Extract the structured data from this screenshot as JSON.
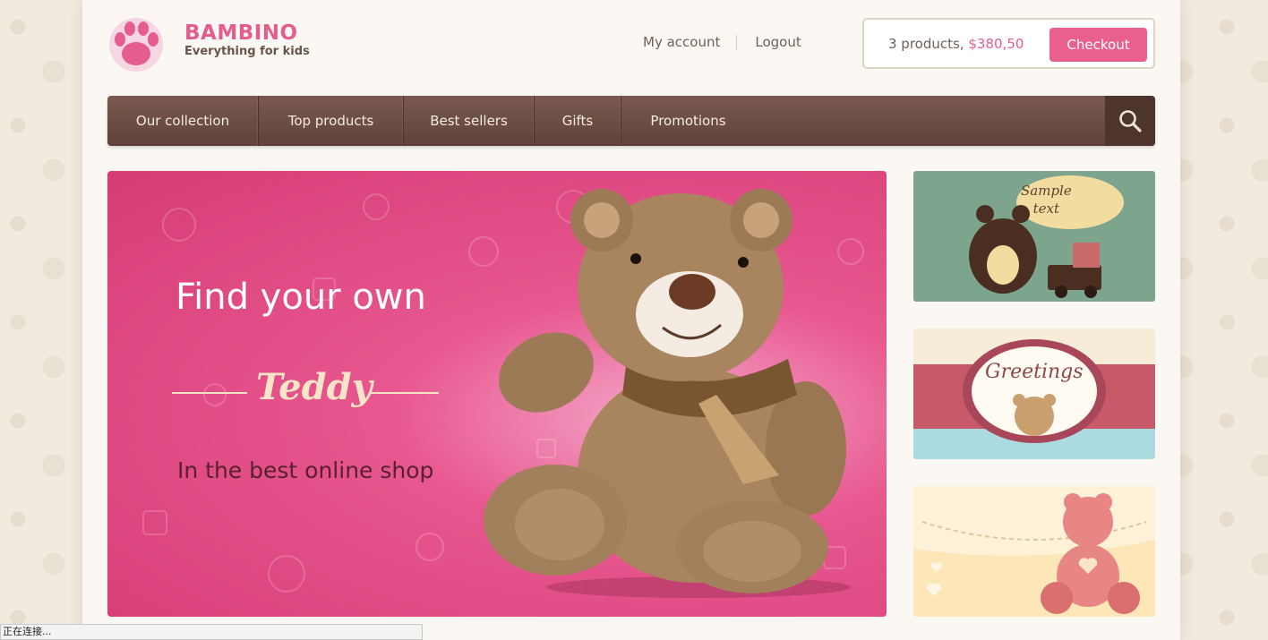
{
  "brand": {
    "name": "BAMBINO",
    "tagline": "Everything for kids"
  },
  "account": {
    "my_account": "My account",
    "logout": "Logout"
  },
  "cart": {
    "count_text": "3 products,",
    "total": "$380,50",
    "checkout_label": "Checkout"
  },
  "nav": {
    "items": [
      {
        "label": "Our collection"
      },
      {
        "label": "Top products"
      },
      {
        "label": "Best sellers"
      },
      {
        "label": "Gifts"
      },
      {
        "label": "Promotions"
      }
    ]
  },
  "hero": {
    "title": "Find your own",
    "highlight": "Teddy",
    "subtitle": "In the best online shop"
  },
  "side_banners": {
    "sample_line1": "Sample",
    "sample_line2": "text",
    "greetings": "Greetings"
  },
  "status_bar": {
    "text": "正在连接..."
  },
  "colors": {
    "accent": "#e55d8f",
    "nav": "#6b4c42",
    "hero": "#e8578f"
  }
}
